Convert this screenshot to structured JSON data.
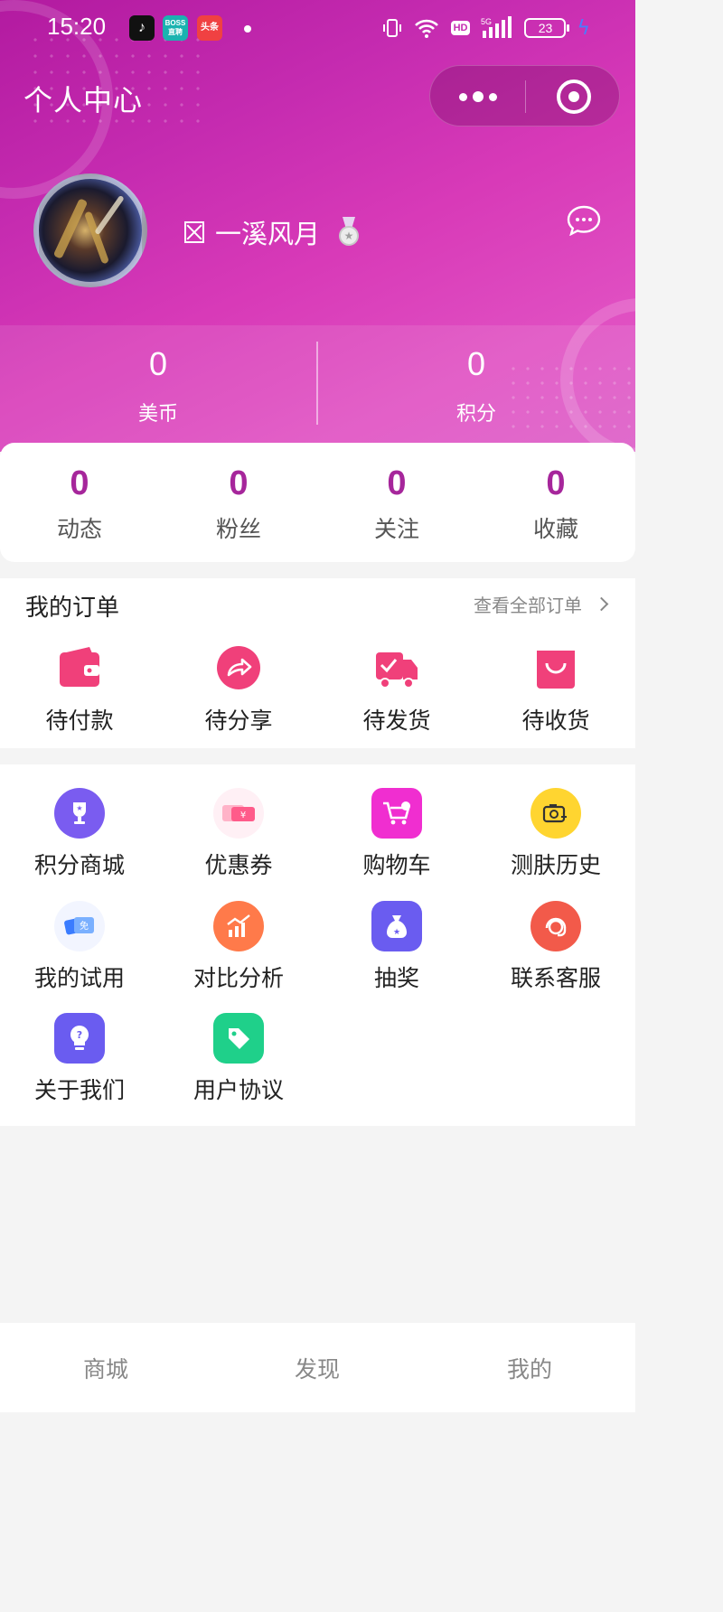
{
  "status_bar": {
    "time": "15:20",
    "apps": [
      {
        "name": "tiktok-icon",
        "label": "♪"
      },
      {
        "name": "boss-icon",
        "label": "BOSS 直聘"
      },
      {
        "name": "toutiao-icon",
        "label": "头条"
      }
    ],
    "hd": "HD",
    "network": "5G",
    "battery": "23"
  },
  "header": {
    "title": "个人中心",
    "username": "一溪风月"
  },
  "stats": [
    {
      "value": "0",
      "label": "美币"
    },
    {
      "value": "0",
      "label": "积分"
    }
  ],
  "social": [
    {
      "value": "0",
      "label": "动态"
    },
    {
      "value": "0",
      "label": "粉丝"
    },
    {
      "value": "0",
      "label": "关注"
    },
    {
      "value": "0",
      "label": "收藏"
    }
  ],
  "orders": {
    "title": "我的订单",
    "view_all": "查看全部订单",
    "items": [
      {
        "label": "待付款",
        "icon": "wallet-icon"
      },
      {
        "label": "待分享",
        "icon": "share-icon"
      },
      {
        "label": "待发货",
        "icon": "truck-icon"
      },
      {
        "label": "待收货",
        "icon": "shopping-bag-icon"
      }
    ]
  },
  "services": [
    {
      "label": "积分商城",
      "icon": "trophy-icon",
      "color": "#7a5cf0"
    },
    {
      "label": "优惠券",
      "icon": "coupon-icon",
      "color": "#ff5b8a"
    },
    {
      "label": "购物车",
      "icon": "cart-icon",
      "color": "#f02ed0"
    },
    {
      "label": "测肤历史",
      "icon": "camera-icon",
      "color": "#ffd530"
    },
    {
      "label": "我的试用",
      "icon": "trial-icon",
      "color": "#4a8cff"
    },
    {
      "label": "对比分析",
      "icon": "chart-up-icon",
      "color": "#ff7a4a"
    },
    {
      "label": "抽奖",
      "icon": "money-bag-icon",
      "color": "#6a5cf0"
    },
    {
      "label": "联系客服",
      "icon": "headset-icon",
      "color": "#f25a4a"
    },
    {
      "label": "关于我们",
      "icon": "bulb-icon",
      "color": "#6a5cf0"
    },
    {
      "label": "用户协议",
      "icon": "tag-icon",
      "color": "#1fd08a"
    }
  ],
  "tabs": [
    {
      "label": "商城"
    },
    {
      "label": "发现"
    },
    {
      "label": "我的"
    }
  ]
}
